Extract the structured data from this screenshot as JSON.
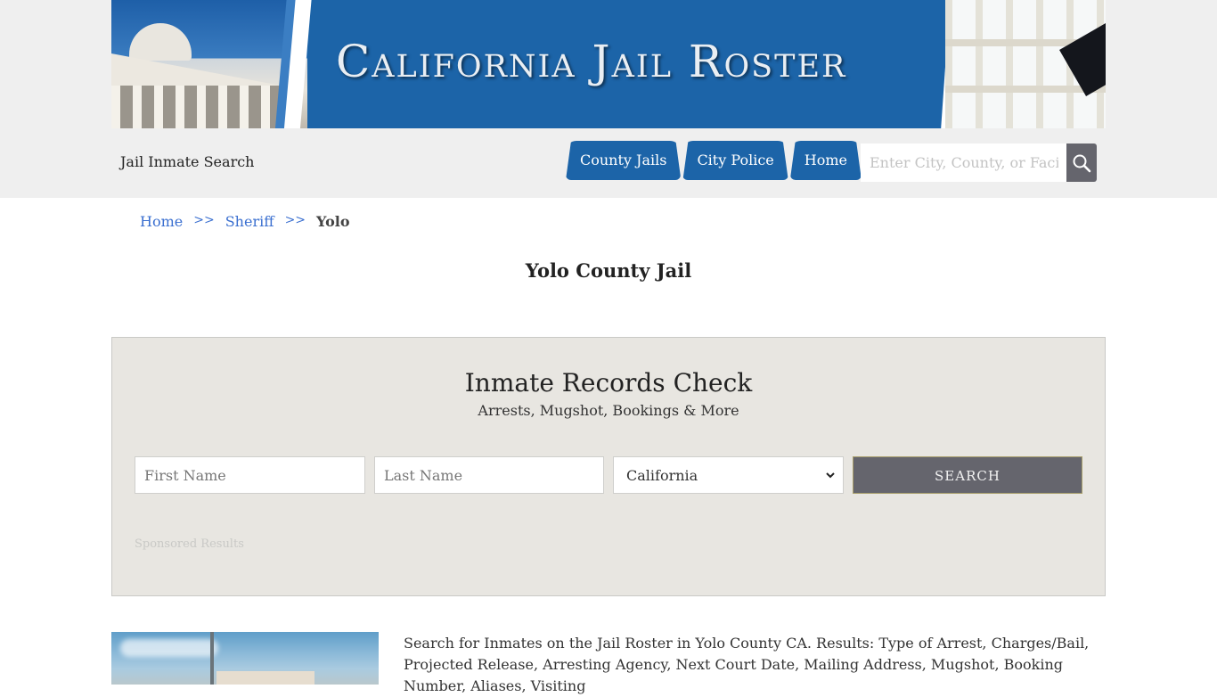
{
  "header": {
    "banner_title": "California Jail Roster",
    "site_label": "Jail Inmate Search"
  },
  "nav": {
    "tabs": [
      {
        "label": "County Jails"
      },
      {
        "label": "City Police"
      },
      {
        "label": "Home"
      }
    ],
    "search_placeholder": "Enter City, County, or Facility",
    "search_icon": "magnifier-icon"
  },
  "breadcrumb": {
    "items": [
      {
        "label": "Home"
      },
      {
        "label": "Sheriff"
      }
    ],
    "separator": ">>",
    "current": "Yolo"
  },
  "page": {
    "title": "Yolo County Jail"
  },
  "records": {
    "heading": "Inmate Records Check",
    "subheading": "Arrests, Mugshot, Bookings & More",
    "first_name_placeholder": "First Name",
    "last_name_placeholder": "Last Name",
    "state_selected": "California",
    "search_label": "SEARCH",
    "sponsored_label": "Sponsored Results"
  },
  "description": "Search for Inmates on the Jail Roster in Yolo County CA. Results: Type of Arrest, Charges/Bail, Projected Release, Arresting Agency, Next Court Date, Mailing Address, Mugshot, Booking Number, Aliases, Visiting",
  "colors": {
    "brand_blue": "#1c64a8",
    "button_gray": "#65656d",
    "link_blue": "#3a6fd0",
    "panel_bg": "#e8e6e1"
  }
}
